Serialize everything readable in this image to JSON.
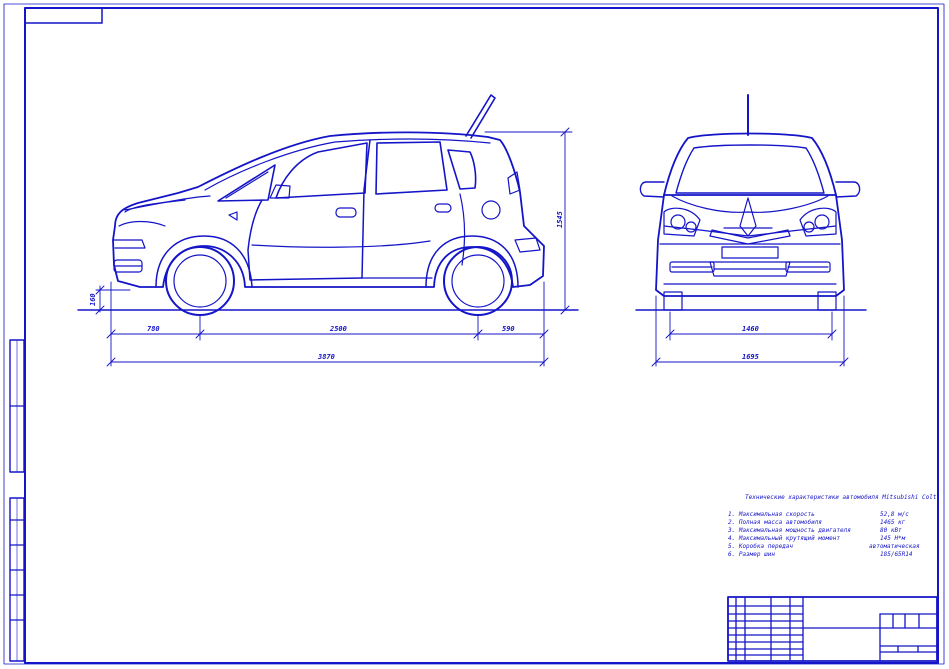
{
  "drawing": {
    "line_color": "#1414c8",
    "background": "#ffffff"
  },
  "side_view": {
    "dims": {
      "front_overhang": "780",
      "wheelbase": "2500",
      "rear_overhang": "590",
      "overall_length": "3870",
      "height": "1545",
      "ground_clearance": "160"
    }
  },
  "front_view": {
    "dims": {
      "track": "1460",
      "overall_width": "1695"
    }
  },
  "spec_table": {
    "title": "Технические характеристики автомобиля Mitsubishi Colt",
    "rows": [
      {
        "label": "1. Максимальная скорость",
        "value": "52,8 м/с"
      },
      {
        "label": "2. Полная масса автомобиля",
        "value": "1465 кг"
      },
      {
        "label": "3. Максимальная мощность двигателя",
        "value": "80 кВт"
      },
      {
        "label": "4. Максимальный крутящий момент",
        "value": "145 Н*м"
      },
      {
        "label": "5. Коробка передач",
        "value": "автоматическая"
      },
      {
        "label": "6. Размер шин",
        "value": "185/65R14"
      }
    ]
  }
}
